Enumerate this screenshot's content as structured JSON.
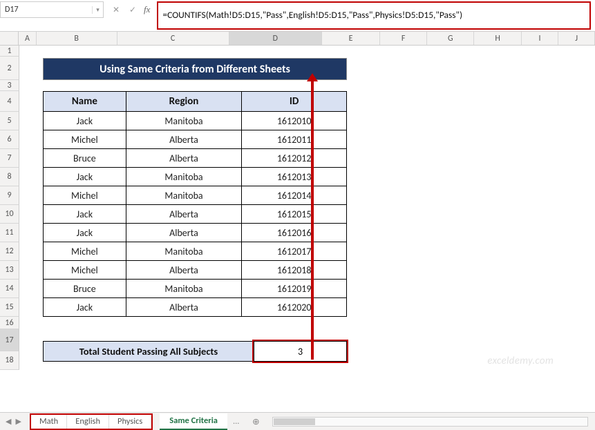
{
  "name_box": {
    "value": "D17"
  },
  "fx": {
    "cancel": "✕",
    "enter": "✓",
    "label": "fx"
  },
  "formula": "=COUNTIFS(Math!D5:D15,\"Pass\",English!D5:D15,\"Pass\",Physics!D5:D15,\"Pass\")",
  "columns": [
    "A",
    "B",
    "C",
    "D",
    "E",
    "F",
    "G",
    "H",
    "I",
    "J"
  ],
  "rows": [
    "1",
    "2",
    "3",
    "4",
    "5",
    "6",
    "7",
    "8",
    "9",
    "10",
    "11",
    "12",
    "13",
    "14",
    "15",
    "16",
    "17",
    "18"
  ],
  "title": "Using Same Criteria from Different Sheets",
  "table": {
    "headers": [
      "Name",
      "Region",
      "ID"
    ],
    "rows": [
      [
        "Jack",
        "Manitoba",
        "1612010"
      ],
      [
        "Michel",
        "Alberta",
        "1612011"
      ],
      [
        "Bruce",
        "Alberta",
        "1612012"
      ],
      [
        "Jack",
        "Manitoba",
        "1612013"
      ],
      [
        "Michel",
        "Manitoba",
        "1612014"
      ],
      [
        "Jack",
        "Alberta",
        "1612015"
      ],
      [
        "Jack",
        "Alberta",
        "1612016"
      ],
      [
        "Michel",
        "Manitoba",
        "1612017"
      ],
      [
        "Michel",
        "Alberta",
        "1612018"
      ],
      [
        "Bruce",
        "Manitoba",
        "1612019"
      ],
      [
        "Jack",
        "Alberta",
        "1612020"
      ]
    ]
  },
  "summary": {
    "label": "Total Student Passing All Subjects",
    "value": "3"
  },
  "tabs": {
    "group": [
      "Math",
      "English",
      "Physics"
    ],
    "active": "Same Criteria",
    "more": "...",
    "plus": "⊕",
    "nav_prev": "◀",
    "nav_next": "▶"
  },
  "watermark": "exceldemy.com"
}
